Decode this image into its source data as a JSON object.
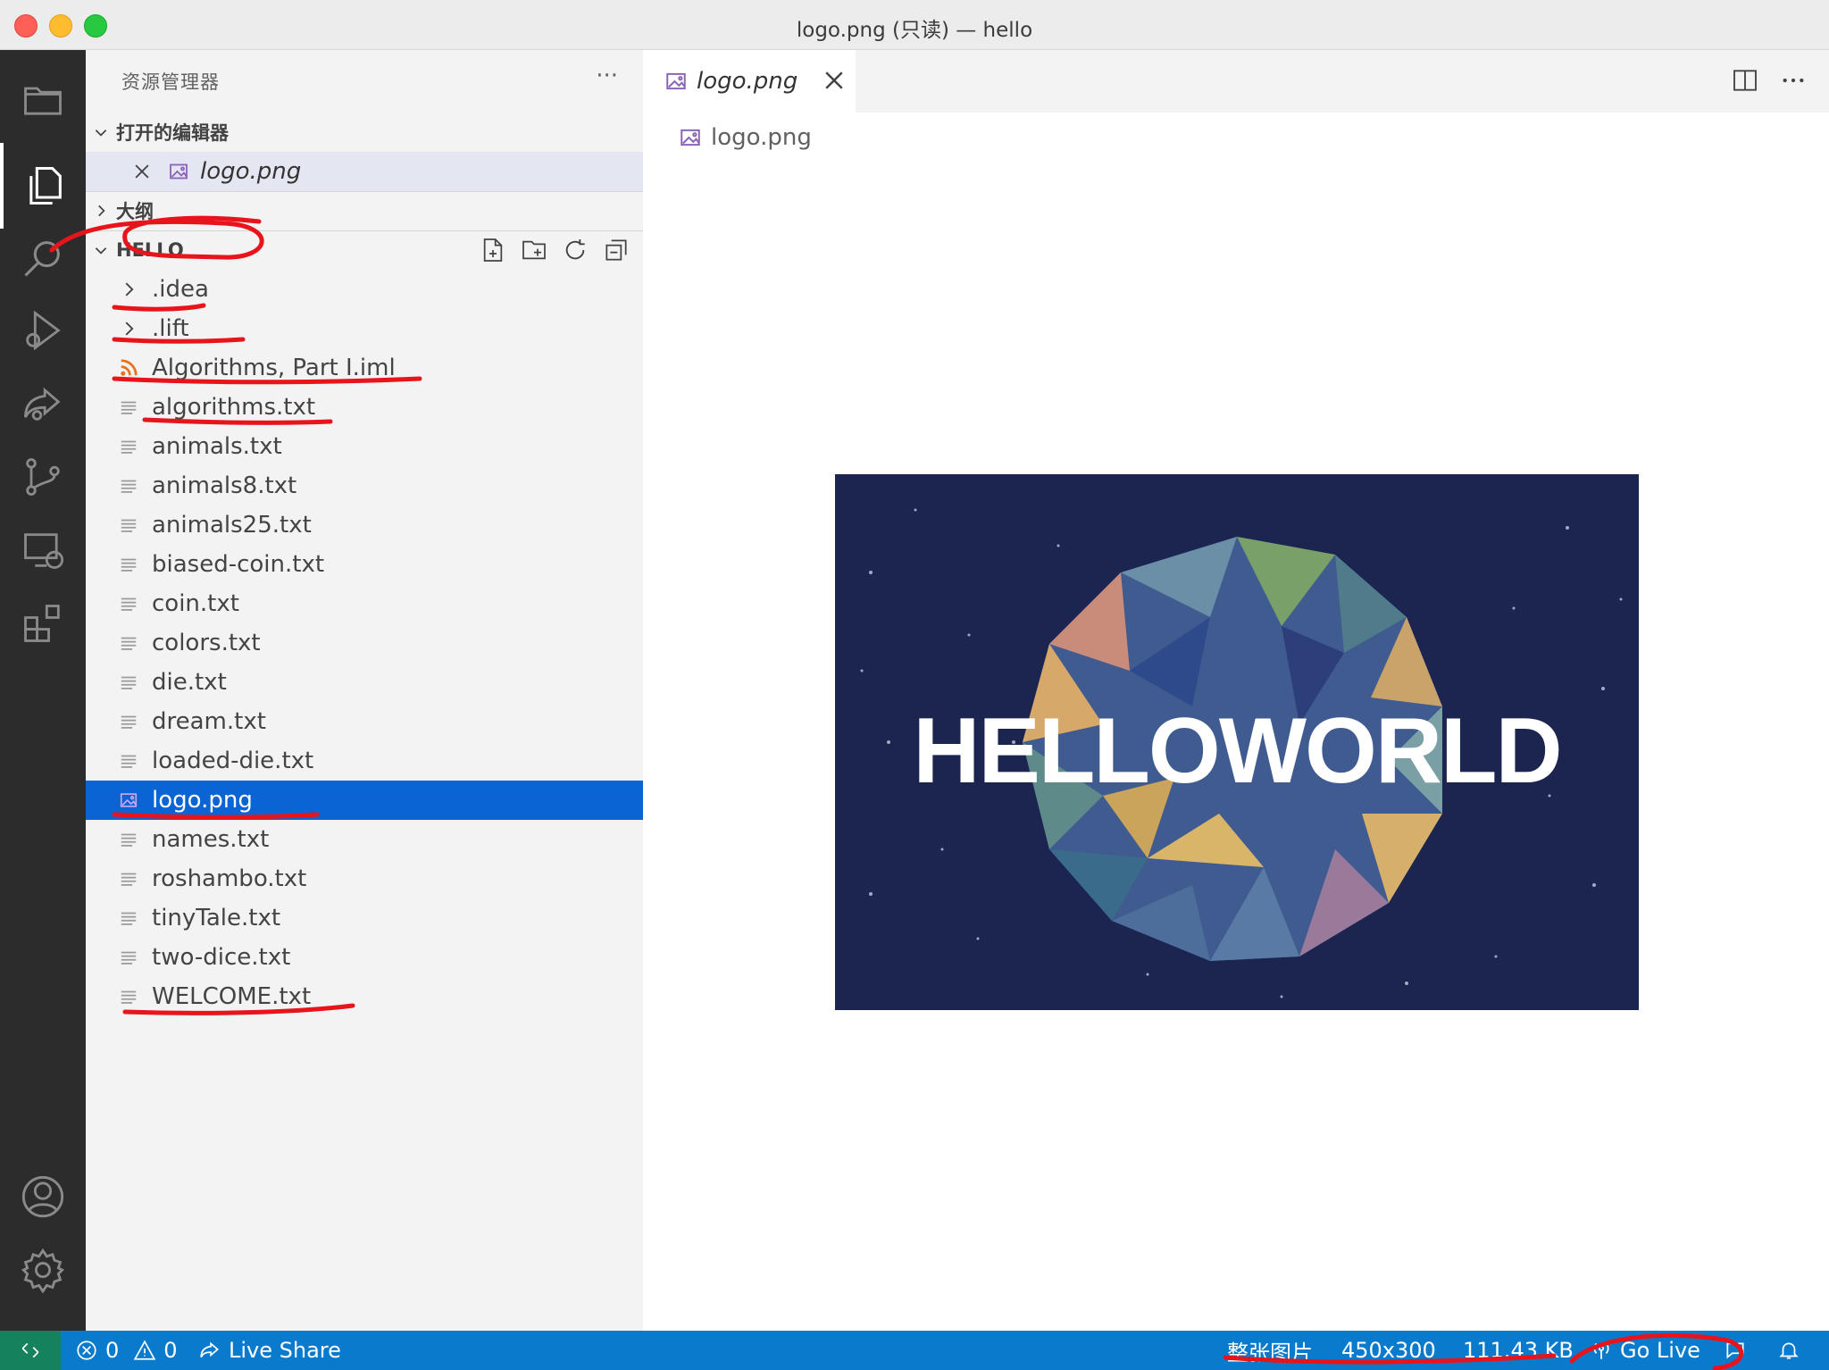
{
  "window": {
    "title": "logo.png (只读) — hello"
  },
  "activity_bar": {
    "items": [
      "explorer-icon",
      "files-icon",
      "search-icon",
      "run-debug-icon",
      "live-share-icon",
      "source-control-icon",
      "remote-explorer-icon",
      "extensions-icon"
    ],
    "bottom_items": [
      "account-icon",
      "settings-gear-icon"
    ]
  },
  "sidebar": {
    "header": "资源管理器",
    "more": "···",
    "open_editors": {
      "label": "打开的编辑器",
      "items": [
        {
          "name": "logo.png"
        }
      ]
    },
    "outline": {
      "label": "大纲"
    },
    "folder": {
      "label": "HELLO",
      "items": [
        {
          "name": ".idea",
          "kind": "folder"
        },
        {
          "name": ".lift",
          "kind": "folder"
        },
        {
          "name": "Algorithms, Part I.iml",
          "kind": "rss"
        },
        {
          "name": "algorithms.txt",
          "kind": "text"
        },
        {
          "name": "animals.txt",
          "kind": "text"
        },
        {
          "name": "animals8.txt",
          "kind": "text"
        },
        {
          "name": "animals25.txt",
          "kind": "text"
        },
        {
          "name": "biased-coin.txt",
          "kind": "text"
        },
        {
          "name": "coin.txt",
          "kind": "text"
        },
        {
          "name": "colors.txt",
          "kind": "text"
        },
        {
          "name": "die.txt",
          "kind": "text"
        },
        {
          "name": "dream.txt",
          "kind": "text"
        },
        {
          "name": "loaded-die.txt",
          "kind": "text"
        },
        {
          "name": "logo.png",
          "kind": "image",
          "selected": true
        },
        {
          "name": "names.txt",
          "kind": "text"
        },
        {
          "name": "roshambo.txt",
          "kind": "text"
        },
        {
          "name": "tinyTale.txt",
          "kind": "text"
        },
        {
          "name": "two-dice.txt",
          "kind": "text"
        },
        {
          "name": "WELCOME.txt",
          "kind": "text"
        }
      ]
    }
  },
  "editor": {
    "tab": {
      "label": "logo.png"
    },
    "breadcrumb": "logo.png",
    "image_text": "HELLOWORLD"
  },
  "statusbar": {
    "errors": "0",
    "warnings": "0",
    "live_share": "Live Share",
    "zoom": "整张图片",
    "dimensions": "450x300",
    "size": "111.43 KB",
    "go_live": "Go Live"
  },
  "colors": {
    "accent": "#0a7acc",
    "selection": "#0b64d4",
    "activity_bar": "#2c2c2c",
    "annotation": "#e8141c"
  }
}
